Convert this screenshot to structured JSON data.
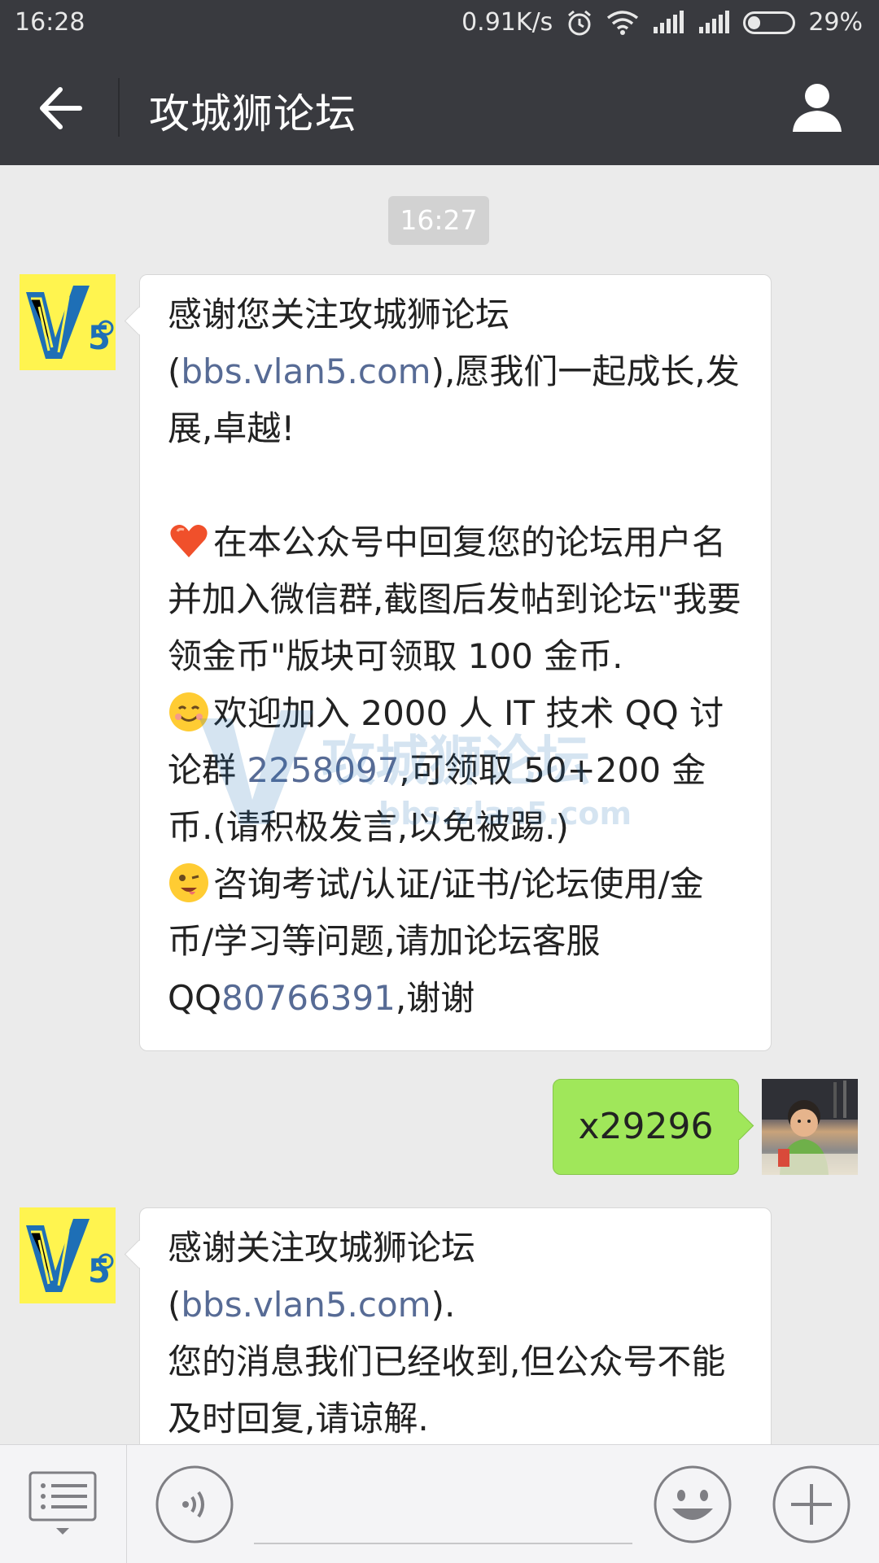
{
  "status_bar": {
    "time": "16:28",
    "network_speed": "0.91K/s",
    "battery_percent_text": "29%",
    "battery_level": 0.29
  },
  "nav": {
    "title": "攻城狮论坛",
    "back_icon": "arrow-left-icon",
    "profile_icon": "person-icon"
  },
  "chat": {
    "timestamp": "16:27",
    "messages": [
      {
        "sender": "official",
        "intro_a": "感谢您关注攻城狮论坛(",
        "intro_link": "bbs.vlan5.com",
        "intro_b": "),愿我们一起成长,发展,卓越!",
        "p1": "在本公众号中回复您的论坛用户名并加入微信群,截图后发帖到论坛\"我要领金币\"版块可领取 100 金币.",
        "p2_a": "欢迎加入 2000 人 IT 技术 QQ 讨论群 ",
        "p2_link": "2258097",
        "p2_b": ",可领取 50+200 金币.(请积极发言,以免被踢.)",
        "p3_a": "咨询考试/认证/证书/论坛使用/金币/学习等问题,请加论坛客服QQ",
        "p3_link": "80766391",
        "p3_b": ",谢谢"
      },
      {
        "sender": "me",
        "text": "x29296"
      },
      {
        "sender": "official",
        "intro_a": "感谢关注攻城狮论坛(",
        "intro_link": "bbs.vlan5.com",
        "intro_b": ").",
        "p1": "您的消息我们已经收到,但公众号不能及时回复,请谅解."
      }
    ]
  },
  "watermark": {
    "text": "攻城狮论坛",
    "url": "bbs.vlan5.com"
  },
  "input_bar": {
    "menu_icon": "list-menu-icon",
    "voice_icon": "voice-icon",
    "emoji_icon": "smiley-icon",
    "plus_icon": "plus-icon"
  },
  "colors": {
    "bar_bg": "#393a3f",
    "chat_bg": "#ebebeb",
    "link": "#576b95",
    "out_bubble": "#a0e75a",
    "avatar_bg": "#fff44f"
  }
}
